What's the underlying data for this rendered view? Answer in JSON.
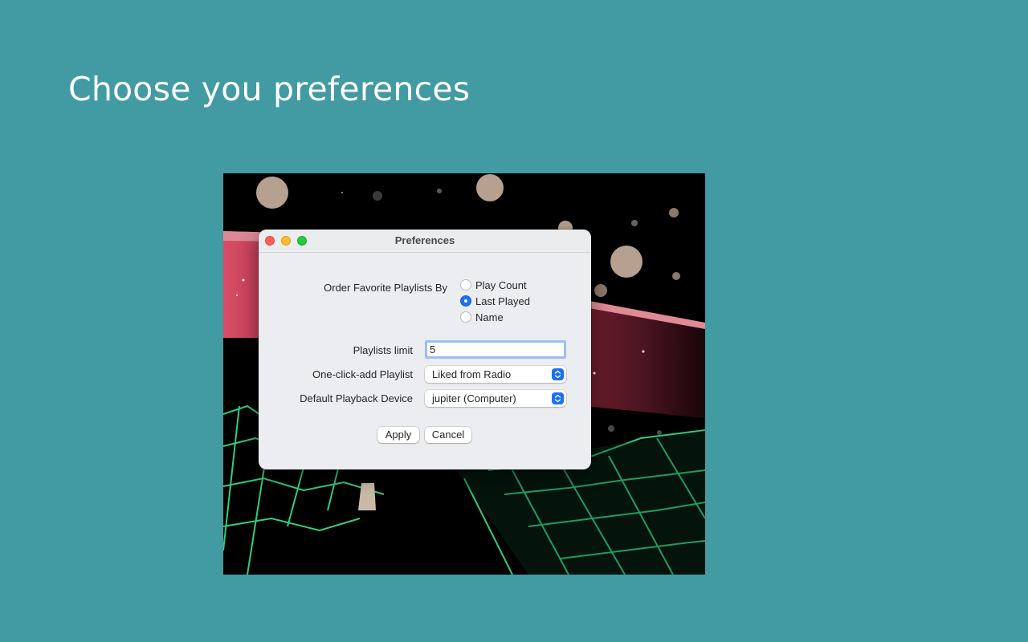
{
  "page": {
    "heading": "Choose you preferences"
  },
  "window": {
    "title": "Preferences",
    "controls": [
      "close",
      "minimize",
      "zoom"
    ]
  },
  "preferences": {
    "order_by": {
      "label": "Order Favorite Playlists By",
      "options": [
        {
          "label": "Play Count",
          "selected": false
        },
        {
          "label": "Last Played",
          "selected": true
        },
        {
          "label": "Name",
          "selected": false
        }
      ]
    },
    "playlists_limit": {
      "label": "Playlists limit",
      "value": "5"
    },
    "one_click_add": {
      "label": "One-click-add Playlist",
      "value": "Liked from Radio"
    },
    "playback_device": {
      "label": "Default Playback Device",
      "value": "jupiter (Computer)"
    }
  },
  "buttons": {
    "apply": "Apply",
    "cancel": "Cancel"
  },
  "colors": {
    "background": "#429aa2",
    "accent": "#1e6ff1",
    "focus_ring": "#9cbff2"
  },
  "icons": {
    "select_arrow": "chevron-up-down-icon"
  }
}
